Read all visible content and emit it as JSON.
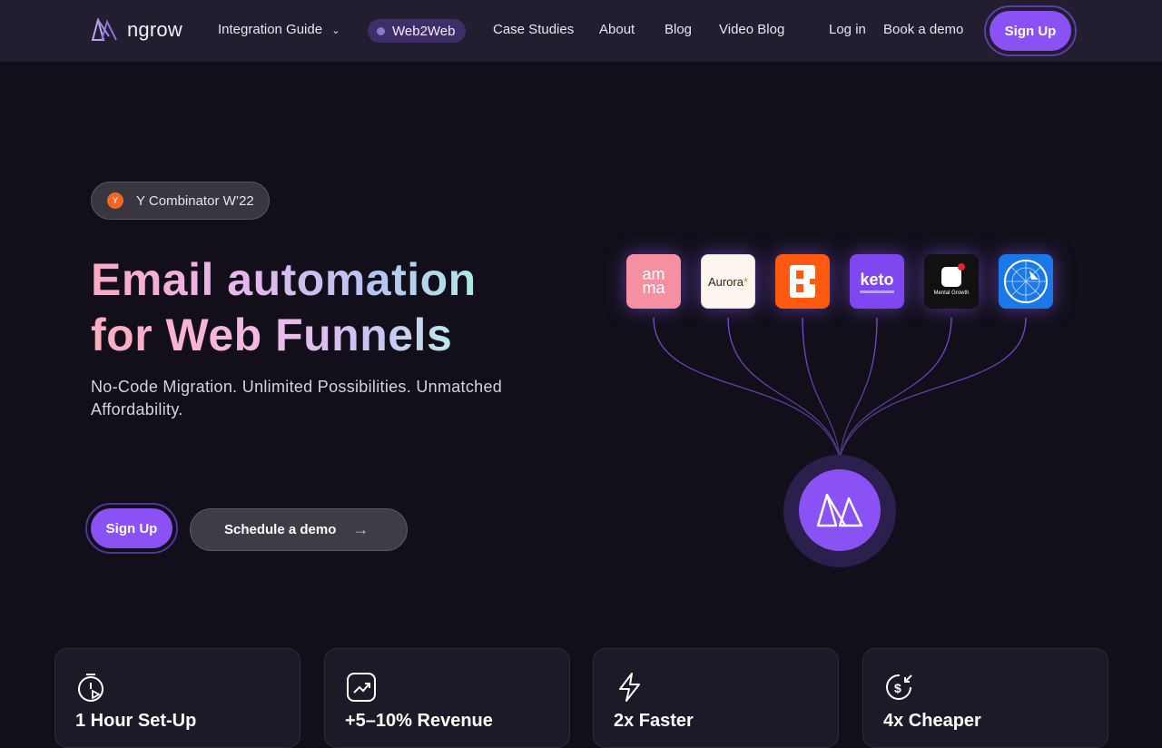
{
  "nav": {
    "logo_text": "ngrow",
    "integration_guide": "Integration Guide",
    "web2web": "Web2Web",
    "case_studies": "Case Studies",
    "about": "About",
    "blog": "Blog",
    "video_blog": "Video Blog",
    "log_in": "Log in",
    "book_demo": "Book a demo",
    "sign_up": "Sign Up"
  },
  "hero": {
    "badge": "Y Combinator W’22",
    "badge_icon_letter": "Y",
    "headline_line1": "Email automation",
    "headline_line2": "for Web Funnels",
    "subtitle": "No-Code Migration. Unlimited Possibilities. Unmatched Affordability.",
    "cta_signup": "Sign Up",
    "cta_demo": "Schedule a demo"
  },
  "brands": [
    {
      "name": "amma",
      "label_top": "am",
      "label_bottom": "ma",
      "color": "#f58fa2"
    },
    {
      "name": "aurora",
      "label": "Aurora",
      "mark": "*",
      "color": "#fcf6ee"
    },
    {
      "name": "b-brand",
      "color": "#ff5a0f"
    },
    {
      "name": "keto",
      "label": "keto",
      "color": "#7f47f0"
    },
    {
      "name": "mental-growth",
      "label": "Mental Growth",
      "color": "#111111"
    },
    {
      "name": "blue-brand",
      "color": "#1a78e8"
    }
  ],
  "features": [
    {
      "title": "1 Hour Set-Up",
      "icon": "timer-icon"
    },
    {
      "title": "+5–10% Revenue",
      "icon": "trend-up-icon"
    },
    {
      "title": "2x Faster",
      "icon": "lightning-icon"
    },
    {
      "title": "4x Cheaper",
      "icon": "dollar-down-icon"
    }
  ],
  "colors": {
    "accent": "#8a52f5",
    "background": "#120f1a",
    "nav_background": "#231d30"
  }
}
